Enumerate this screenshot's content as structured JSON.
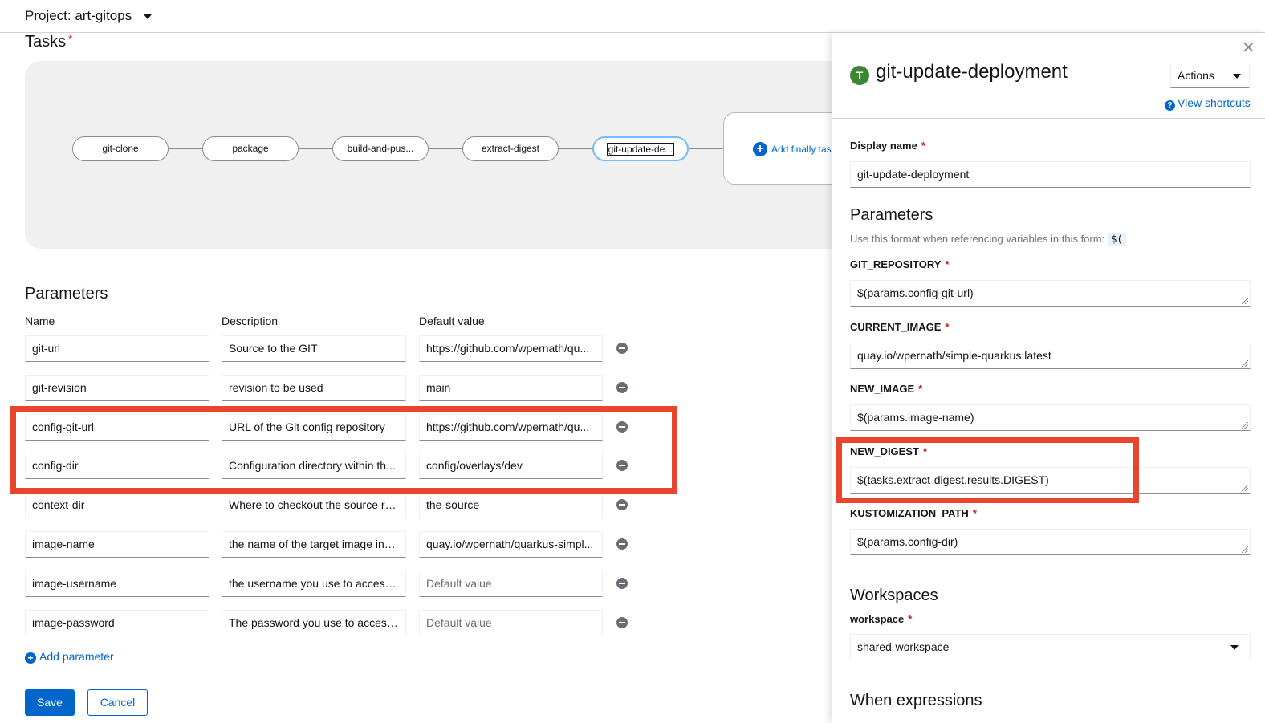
{
  "header": {
    "project_label": "Project: art-gitops"
  },
  "tasks": {
    "title": "Tasks",
    "required_mark": "*",
    "nodes": [
      "git-clone",
      "package",
      "build-and-pus...",
      "extract-digest",
      "git-update-de..."
    ],
    "add_finally_label": "Add finally tas"
  },
  "parameters": {
    "title": "Parameters",
    "columns": [
      "Name",
      "Description",
      "Default value"
    ],
    "rows": [
      {
        "name": "git-url",
        "description": "Source to the GIT",
        "default": "https://github.com/wpernath/qu..."
      },
      {
        "name": "git-revision",
        "description": "revision to be used",
        "default": "main"
      },
      {
        "name": "config-git-url",
        "description": "URL of the Git config repository",
        "default": "https://github.com/wpernath/qu..."
      },
      {
        "name": "config-dir",
        "description": "Configuration directory within th...",
        "default": "config/overlays/dev"
      },
      {
        "name": "context-dir",
        "description": "Where to checkout the source re...",
        "default": "the-source"
      },
      {
        "name": "image-name",
        "description": "the name of the target image inc...",
        "default": "quay.io/wpernath/quarkus-simpl..."
      },
      {
        "name": "image-username",
        "description": "the username you use to access ...",
        "default": "Default value"
      },
      {
        "name": "image-password",
        "description": "The password you use to access ...",
        "default": "Default value"
      }
    ],
    "add_label": "Add parameter"
  },
  "footer": {
    "save_label": "Save",
    "cancel_label": "Cancel"
  },
  "side_panel": {
    "badge": "T",
    "title": "git-update-deployment",
    "actions_label": "Actions",
    "shortcuts_label": "View shortcuts",
    "display_name_label": "Display name",
    "display_name_value": "git-update-deployment",
    "parameters_title": "Parameters",
    "help_text": "Use this format when referencing variables in this form:",
    "help_code": "$(",
    "params": [
      {
        "label": "GIT_REPOSITORY",
        "value": "$(params.config-git-url)"
      },
      {
        "label": "CURRENT_IMAGE",
        "value": "quay.io/wpernath/simple-quarkus:latest"
      },
      {
        "label": "NEW_IMAGE",
        "value": "$(params.image-name)"
      },
      {
        "label": "NEW_DIGEST",
        "value": "$(tasks.extract-digest.results.DIGEST)"
      },
      {
        "label": "KUSTOMIZATION_PATH",
        "value": "$(params.config-dir)"
      }
    ],
    "workspaces_title": "Workspaces",
    "workspace_label": "workspace",
    "workspace_value": "shared-workspace",
    "when_title": "When expressions"
  },
  "colors": {
    "accent": "#0066cc",
    "highlight": "#e8452c",
    "task_badge": "#3e8635",
    "required": "#c9190b"
  }
}
